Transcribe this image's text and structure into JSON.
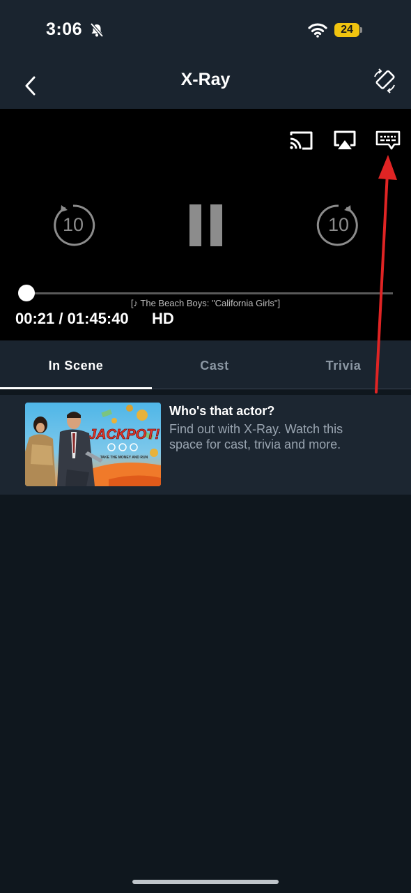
{
  "status_bar": {
    "time": "3:06",
    "battery_level": "24",
    "icons": [
      "bell-slash-icon",
      "wifi-icon",
      "battery-icon"
    ]
  },
  "header": {
    "title": "X-Ray",
    "back_icon": "chevron-left-icon",
    "rotate_icon": "rotate-screen-icon"
  },
  "player": {
    "top_icons": [
      "cast-icon",
      "airplay-icon",
      "subtitles-icon"
    ],
    "rewind_seconds": "10",
    "forward_seconds": "10",
    "caption": "[♪ The Beach Boys: \"California Girls\"]",
    "time_readout": "00:21 / 01:45:40",
    "quality": "HD",
    "progress_fraction": 0.003
  },
  "tabs": [
    {
      "label": "In Scene",
      "active": true
    },
    {
      "label": "Cast",
      "active": false
    },
    {
      "label": "Trivia",
      "active": false
    }
  ],
  "xray_card": {
    "title": "Who's that actor?",
    "description": "Find out with X-Ray. Watch this space for cast, trivia and more.",
    "poster": {
      "title": "JACKPOT!",
      "tagline": "TAKE THE MONEY AND RUN"
    }
  },
  "colors": {
    "background": "#0f171e",
    "header": "#1a242f",
    "player": "#000000",
    "battery": "#f1c40f",
    "muted_text": "#9aa5b1",
    "annotation_arrow": "#e02424"
  }
}
